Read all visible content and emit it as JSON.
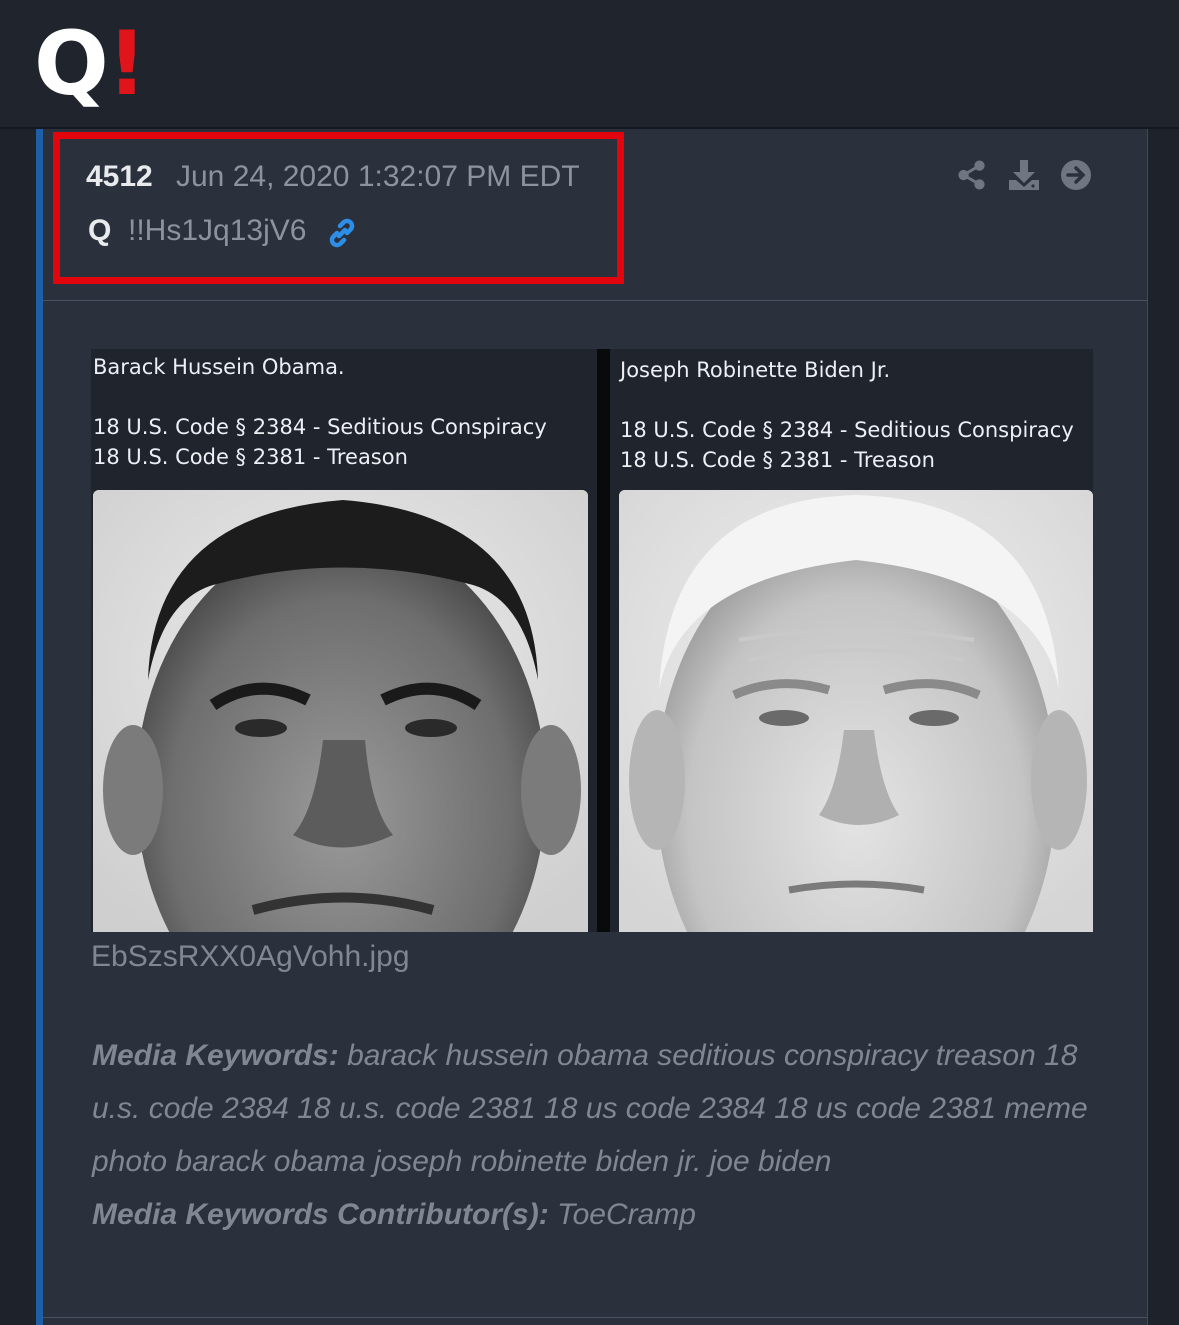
{
  "app": {
    "logo_letter": "Q",
    "logo_mark": "!",
    "brand_white": "#ffffff",
    "brand_red": "#e0141b"
  },
  "post": {
    "number": "4512",
    "datetime": "Jun 24, 2020 1:32:07 PM EDT",
    "author": "Q",
    "tripcode": "!!Hs1Jq13jV6",
    "link_icon": "link-icon",
    "actions": [
      {
        "icon": "share-icon"
      },
      {
        "icon": "download-icon"
      },
      {
        "icon": "arrow-right-circle-icon"
      }
    ],
    "highlight_color": "#e3050d",
    "accent_color": "#1f5fa8"
  },
  "media": {
    "left_panel": {
      "name_line": "Barack Hussein Obama.",
      "code_line_1": "18 U.S. Code § 2384 - Seditious Conspiracy",
      "code_line_2": "18 U.S. Code § 2381 - Treason"
    },
    "right_panel": {
      "name_line": "Joseph Robinette Biden Jr.",
      "code_line_1": "18 U.S. Code § 2384 - Seditious Conspiracy",
      "code_line_2": "18 U.S. Code § 2381 - Treason"
    },
    "filename": "EbSzsRXX0AgVohh.jpg"
  },
  "keywords": {
    "label": "Media Keywords:",
    "text": " barack hussein obama seditious conspiracy treason 18 u.s. code 2384 18 u.s. code 2381 18 us code 2384 18 us code 2381 meme photo barack obama joseph robinette biden jr. joe biden",
    "contributor_label": "Media Keywords Contributor(s):",
    "contributor": " ToeCramp"
  }
}
